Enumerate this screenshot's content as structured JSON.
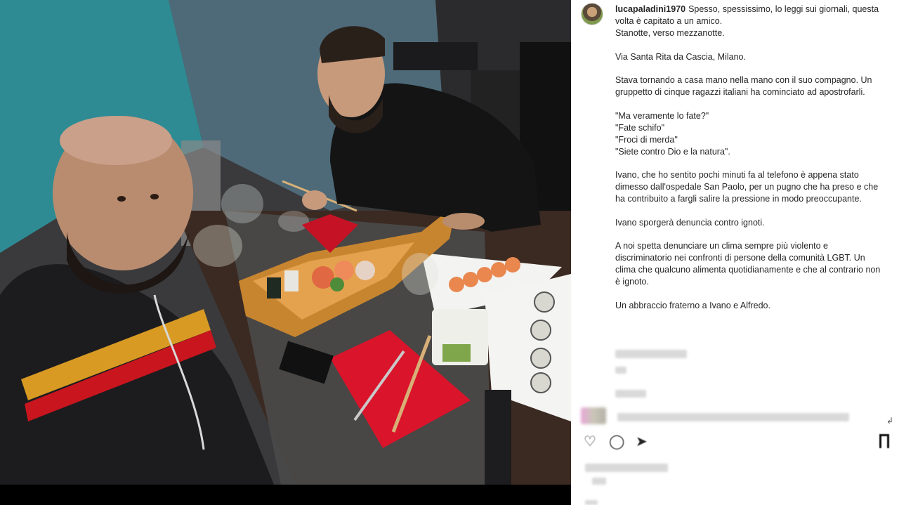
{
  "post": {
    "username": "lucapaladini1970",
    "caption_first_line": "Spesso, spessissimo, lo leggi sui giornali, questa volta è capitato a un amico.",
    "caption_line2": "Stanotte, verso mezzanotte.",
    "paragraphs": [
      "Via Santa Rita da Cascia, Milano.",
      "Stava tornando a casa mano nella mano con il suo compagno. Un gruppetto di cinque ragazzi italiani ha cominciato ad apostrofarli.",
      "\"Ma veramente lo fate?\"\n\"Fate schifo\"\n\"Froci di merda\"\n\"Siete contro Dio e la natura\".",
      "Ivano, che ho sentito pochi minuti fa al telefono è appena stato dimesso dall'ospedale San Paolo, per un pugno che ha preso e che ha contribuito a fargli salire la pressione in modo preoccupante.",
      "Ivano sporgerà denuncia contro ignoti.",
      "A noi spetta denunciare un clima sempre più violento e discriminatorio nei confronti di persone della comunità LGBT. Un clima che qualcuno alimenta quotidianamente e che al contrario non è ignoto.",
      "Un abbraccio fraterno a Ivano e Alfredo."
    ]
  },
  "icons": {
    "avatar": "profile-avatar",
    "like": "heart-icon",
    "comment": "comment-icon",
    "share": "share-icon",
    "save": "bookmark-icon",
    "reply": "reply-icon"
  },
  "colors": {
    "panel_bg": "#ffffff",
    "text": "#262626",
    "wall_teal": "#2f8b93",
    "napkin_red": "#d9142b"
  }
}
